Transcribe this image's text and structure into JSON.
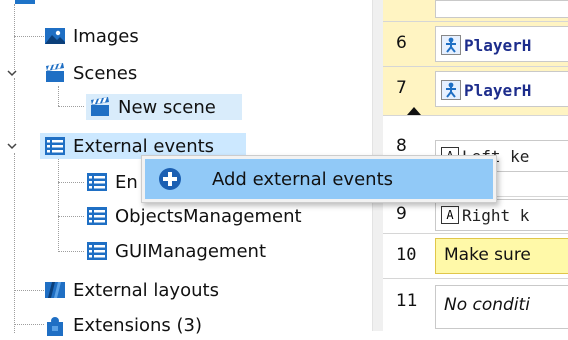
{
  "tree": {
    "items": [
      {
        "label": "Images"
      },
      {
        "label": "Scenes"
      },
      {
        "label": "New scene"
      },
      {
        "label": "External events"
      },
      {
        "label": "En"
      },
      {
        "label": "ObjectsManagement"
      },
      {
        "label": "GUIManagement"
      },
      {
        "label": "External layouts"
      },
      {
        "label": "Extensions (3)"
      }
    ]
  },
  "context_menu": {
    "item_label": "Add external events"
  },
  "events": {
    "rows": [
      {
        "num": "6",
        "text": "PlayerH"
      },
      {
        "num": "7",
        "text": "PlayerH"
      },
      {
        "num": "8",
        "key": "A",
        "text": "Left ke"
      },
      {
        "num": "9",
        "key": "A",
        "text": "Right k"
      },
      {
        "num": "10",
        "text": "Make sure"
      },
      {
        "num": "11",
        "text": "No conditi"
      }
    ]
  },
  "colors": {
    "selection": "#cce8ff",
    "menu_highlight": "#91c9f7",
    "comment_yellow": "#fff9a8",
    "event_blue": "#1d2d8c"
  }
}
